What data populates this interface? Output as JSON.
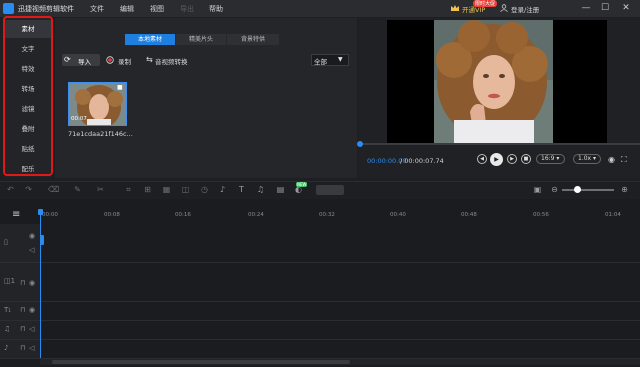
{
  "app": {
    "title": "迅捷视频剪辑软件"
  },
  "menu": {
    "file": "文件",
    "edit": "编辑",
    "view": "视图",
    "hidden": "导出",
    "help": "帮助"
  },
  "account": {
    "vip": "开通VIP",
    "vip_badge": "限时大促",
    "login": "登录/注册"
  },
  "window": {
    "minimize": "—",
    "maximize": "☐",
    "close": "✕"
  },
  "sidebar": {
    "items": [
      {
        "label": "素材"
      },
      {
        "label": "文字"
      },
      {
        "label": "特效"
      },
      {
        "label": "转场"
      },
      {
        "label": "滤镜"
      },
      {
        "label": "叠附"
      },
      {
        "label": "贴纸"
      },
      {
        "label": "配乐"
      }
    ],
    "highlight_color": "#e01818"
  },
  "media": {
    "tabs": [
      {
        "label": "本地素材"
      },
      {
        "label": "精美片头"
      },
      {
        "label": "背景特供"
      }
    ],
    "import_label": "导入",
    "record_label": "录制",
    "convert_label": "音视频转换",
    "filter_value": "全部",
    "clip": {
      "duration": "00:07",
      "name": "71e1cdaa21f146c..."
    }
  },
  "preview": {
    "current_time": "00:00:00.00",
    "total_time": "/ 00:00:07.74",
    "aspect": "16:9",
    "speed": "1.0x"
  },
  "toolbar": {
    "new_badge": "NEW"
  },
  "timeline": {
    "ticks": [
      "00:00",
      "00:08",
      "00:16",
      "00:24",
      "00:32",
      "00:40",
      "00:48",
      "00:56",
      "01:04"
    ]
  },
  "colors": {
    "accent": "#2a8cf0",
    "background": "#1e1f22"
  }
}
